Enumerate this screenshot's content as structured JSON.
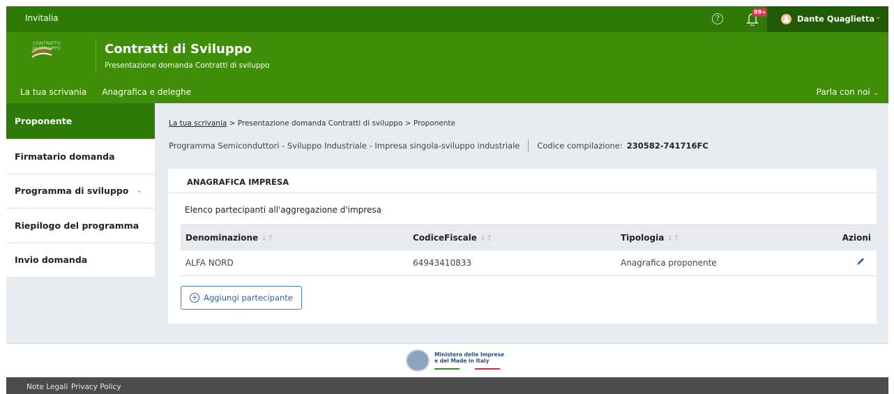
{
  "topbar": {
    "brand": "Invitalia",
    "help_icon": "?",
    "notifications_badge": "99+",
    "user_name": "Dante Quaglietta"
  },
  "header": {
    "logo_text": "CONTRATTO DI SVILUPPO",
    "title": "Contratti di Sviluppo",
    "subtitle": "Presentazione domanda Contratti di sviluppo",
    "nav": [
      "La tua scrivania",
      "Anagrafica e deleghe"
    ],
    "nav_right": "Parla con noi"
  },
  "sidebar": {
    "items": [
      {
        "label": "Proponente",
        "active": true
      },
      {
        "label": "Firmatario domanda"
      },
      {
        "label": "Programma di sviluppo",
        "has_submenu": true
      },
      {
        "label": "Riepilogo del programma"
      },
      {
        "label": "Invio domanda"
      }
    ]
  },
  "breadcrumb": {
    "link": "La tua scrivania",
    "rest": " > Presentazione domanda Contratti di sviluppo  > Proponente"
  },
  "info": {
    "program": "Programma Semiconduttori - Sviluppo Industriale  -  Impresa singola-sviluppo industriale",
    "code_label": "Codice compilazione:",
    "code_value": "230582-741716FC"
  },
  "card": {
    "title": "ANAGRAFICA IMPRESA",
    "list_title": "Elenco partecipanti all'aggregazione d'impresa",
    "columns": [
      "Denominazione",
      "CodiceFiscale",
      "Tipologia",
      "Azioni"
    ],
    "rows": [
      [
        "ALFA NORD",
        "64943410833",
        "Anagrafica proponente"
      ]
    ],
    "add_button": "Aggiungi partecipante"
  },
  "footer": {
    "ministry_line1": "Ministero delle Imprese",
    "ministry_line2": "e del Made in Italy",
    "links": [
      "Note Legali",
      "Privacy Policy"
    ]
  },
  "colors": {
    "topbar": "#2f7a06",
    "header": "#3f8e07",
    "accent_blue": "#2a64a8"
  }
}
